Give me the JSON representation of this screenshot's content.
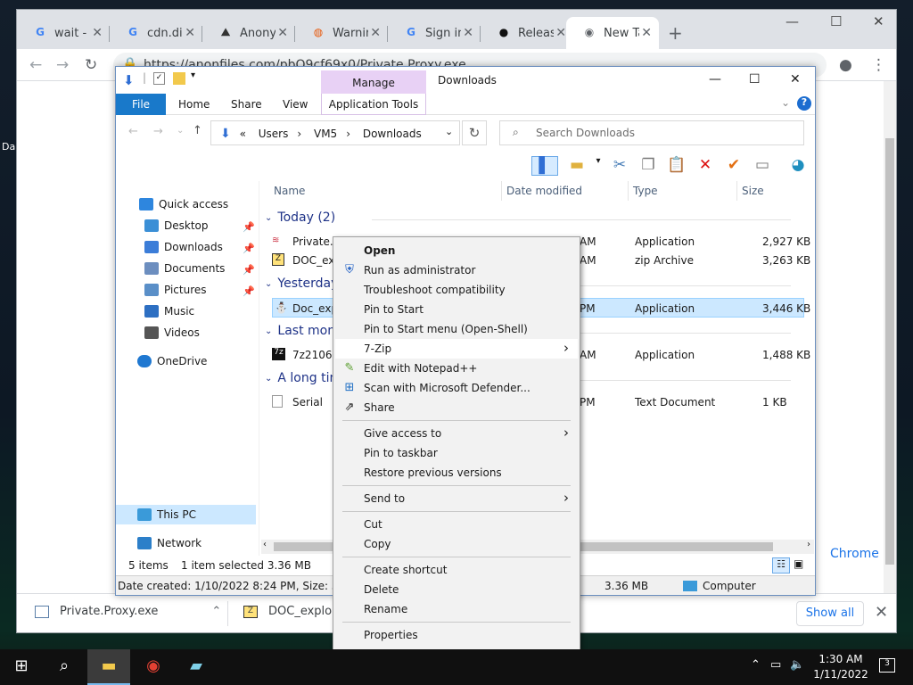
{
  "browser": {
    "tabs": [
      {
        "label": "wait - (",
        "icon": "google-icon"
      },
      {
        "label": "cdn.dis",
        "icon": "google-icon"
      },
      {
        "label": "Anony",
        "icon": "anonfiles-icon"
      },
      {
        "label": "Warnin",
        "icon": "warning-site-icon"
      },
      {
        "label": "Sign in",
        "icon": "google-icon"
      },
      {
        "label": "Releas",
        "icon": "github-icon"
      },
      {
        "label": "New Ta",
        "icon": "chrome-icon"
      }
    ],
    "url": "https://anonfiles.com/pbO9cf69x0/Private.Proxy.exe",
    "downloads": [
      {
        "name": "Private.Proxy.exe",
        "icon": "exe-icon"
      },
      {
        "name": "DOC_exploit.",
        "icon": "zip-icon"
      }
    ],
    "show_all": "Show all",
    "peek_text": "Chrome"
  },
  "explorer": {
    "title": "Downloads",
    "manage": "Manage",
    "ribbon_tabs": [
      "File",
      "Home",
      "Share",
      "View",
      "Application Tools"
    ],
    "breadcrumb": [
      "«",
      "Users",
      "VM5",
      "Downloads"
    ],
    "search_placeholder": "Search Downloads",
    "columns": [
      "Name",
      "Date modified",
      "Type",
      "Size"
    ],
    "sidebar": [
      {
        "label": "Quick access",
        "icon": "star-icon",
        "color": "#2e86de",
        "pinned": false
      },
      {
        "label": "Desktop",
        "icon": "desktop-icon",
        "color": "#3b8fd6",
        "pinned": true
      },
      {
        "label": "Downloads",
        "icon": "download-icon",
        "color": "#3b7dd8",
        "pinned": true
      },
      {
        "label": "Documents",
        "icon": "documents-icon",
        "color": "#6c8ebf",
        "pinned": true
      },
      {
        "label": "Pictures",
        "icon": "pictures-icon",
        "color": "#5a8fc8",
        "pinned": true
      },
      {
        "label": "Music",
        "icon": "music-icon",
        "color": "#2d6fc2",
        "pinned": false
      },
      {
        "label": "Videos",
        "icon": "videos-icon",
        "color": "#555",
        "pinned": false
      },
      {
        "label": "OneDrive",
        "icon": "cloud-icon",
        "color": "#1f78d1",
        "pinned": false
      },
      {
        "label": "This PC",
        "icon": "computer-icon",
        "color": "#3a9ad9",
        "pinned": false
      },
      {
        "label": "Network",
        "icon": "network-icon",
        "color": "#2c7fc9",
        "pinned": false
      }
    ],
    "groups": [
      "Today (2)",
      "Yesterday",
      "Last mont",
      "A long tim"
    ],
    "files": [
      {
        "name": "Private.P",
        "time": "AM",
        "type": "Application",
        "size": "2,927 KB",
        "icon": "exe-icon"
      },
      {
        "name": "DOC_exp",
        "time": "AM",
        "type": "zip Archive",
        "size": "3,263 KB",
        "icon": "zip-icon"
      },
      {
        "name": "Doc_exp",
        "time": "PM",
        "type": "Application",
        "size": "3,446 KB",
        "icon": "exe-icon"
      },
      {
        "name": "7z2106-x",
        "time": "AM",
        "type": "Application",
        "size": "1,488 KB",
        "icon": "7zip-icon"
      },
      {
        "name": "Serial",
        "time": "PM",
        "type": "Text Document",
        "size": "1 KB",
        "icon": "text-file-icon"
      }
    ],
    "status": {
      "items": "5 items",
      "selected": "1 item selected  3.36 MB"
    },
    "details": {
      "created": "Date created: 1/10/2022 8:24 PM, Size: 3.36 MB",
      "size": "3.36 MB",
      "location": "Computer"
    }
  },
  "context_menu": [
    {
      "label": "Open",
      "bold": true
    },
    {
      "label": "Run as administrator",
      "icon": "shield-icon"
    },
    {
      "label": "Troubleshoot compatibility"
    },
    {
      "label": "Pin to Start"
    },
    {
      "label": "Pin to Start menu (Open-Shell)"
    },
    {
      "label": "7-Zip",
      "submenu": true,
      "hover": true
    },
    {
      "label": "Edit with Notepad++",
      "icon": "notepadpp-icon"
    },
    {
      "label": "Scan with Microsoft Defender...",
      "icon": "defender-icon"
    },
    {
      "label": "Share",
      "icon": "share-icon"
    },
    {
      "label": "Give access to",
      "submenu": true
    },
    {
      "label": "Pin to taskbar"
    },
    {
      "label": "Restore previous versions"
    },
    {
      "label": "Send to",
      "submenu": true
    },
    {
      "label": "Cut"
    },
    {
      "label": "Copy"
    },
    {
      "label": "Create shortcut"
    },
    {
      "label": "Delete"
    },
    {
      "label": "Rename"
    },
    {
      "label": "Properties"
    }
  ],
  "taskbar": {
    "time": "1:30 AM",
    "date": "1/11/2022",
    "notifications": "3"
  },
  "desktop": {
    "label": "Da"
  }
}
